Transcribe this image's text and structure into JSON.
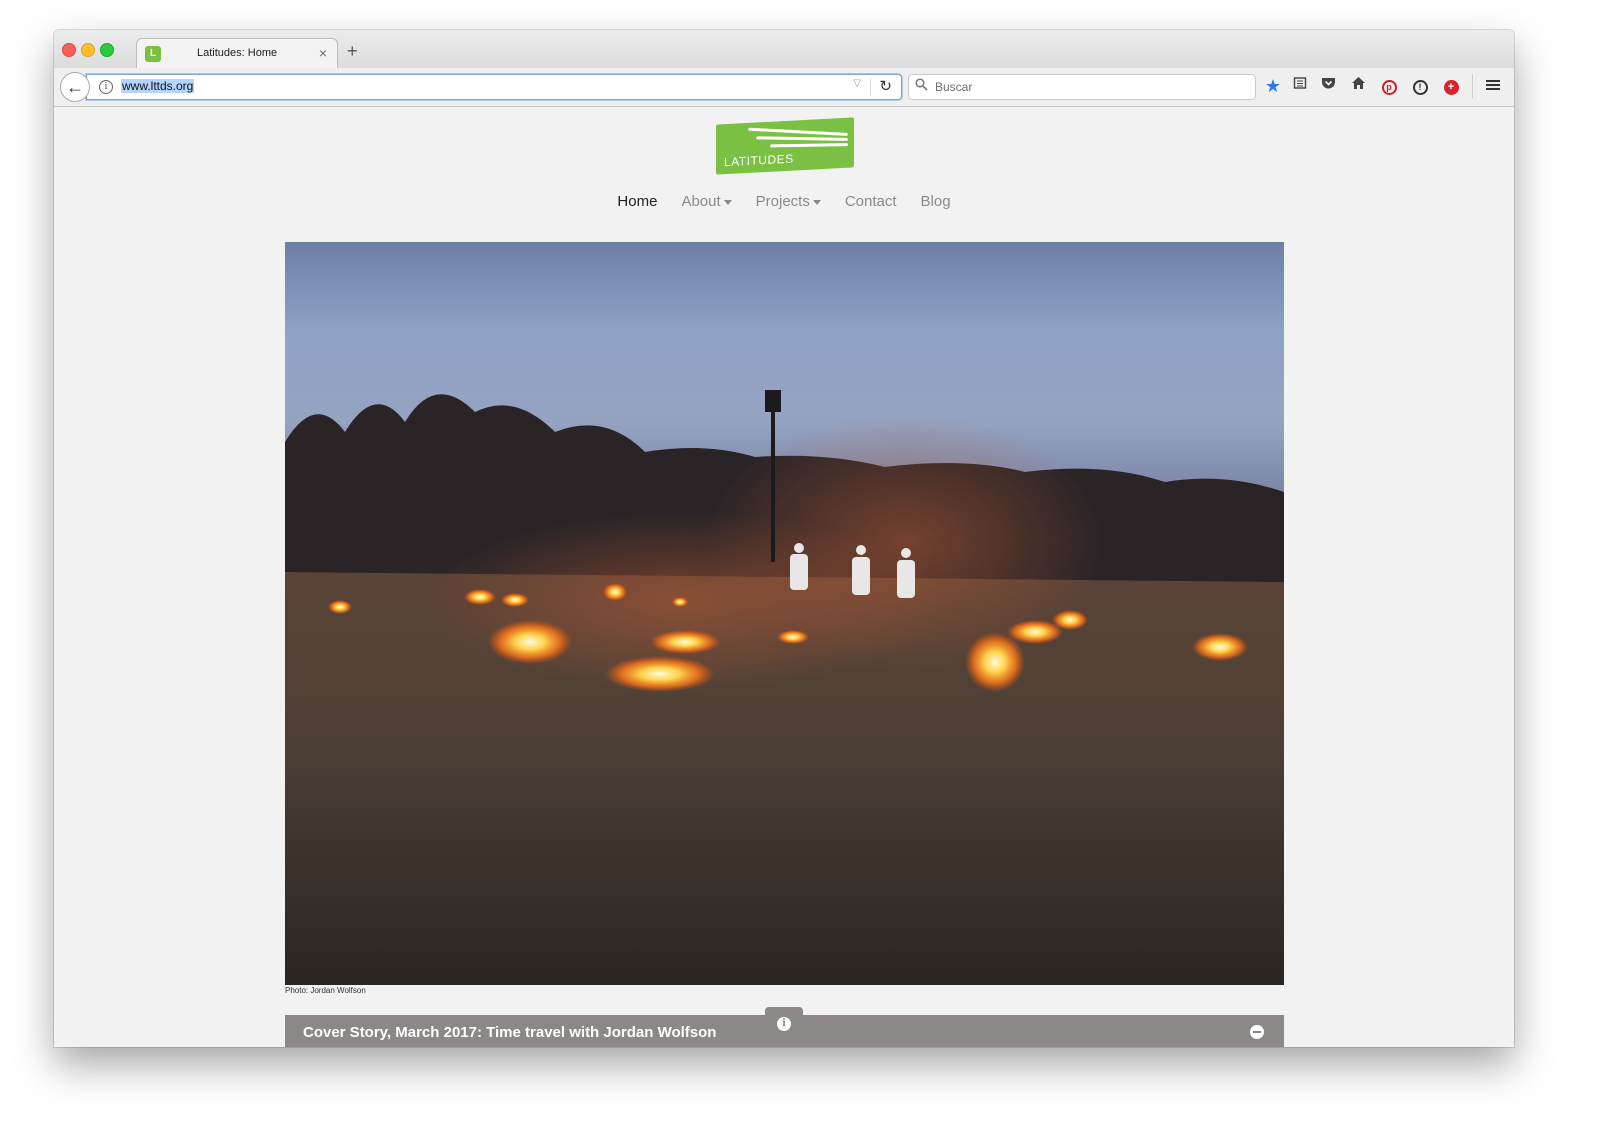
{
  "browser": {
    "tab_title": "Latitudes: Home",
    "favicon_letter": "L",
    "tab_close": "×",
    "new_tab": "+",
    "url": "www.lttds.org",
    "search_placeholder": "Buscar",
    "back": "←",
    "reload": "↻",
    "url_dropdown": "▽",
    "search_icon": "⚲",
    "toolbar_icons": [
      "star-icon",
      "reading-list-icon",
      "pocket-icon",
      "home-icon",
      "pinterest-icon",
      "password-icon",
      "plus-extension-icon",
      "menu-icon"
    ],
    "accent": "#2c7ce8"
  },
  "site": {
    "logo_text": "LATITUDES",
    "logo_color": "#7ac143",
    "nav": [
      "Home",
      "About",
      "Projects",
      "Contact",
      "Blog"
    ],
    "active_nav": "Home",
    "hero_caption": "Photo: Jordan Wolfson",
    "story_title": "Cover Story, March 2017: Time travel with Jordan Wolfson",
    "info_glyph": "i"
  }
}
